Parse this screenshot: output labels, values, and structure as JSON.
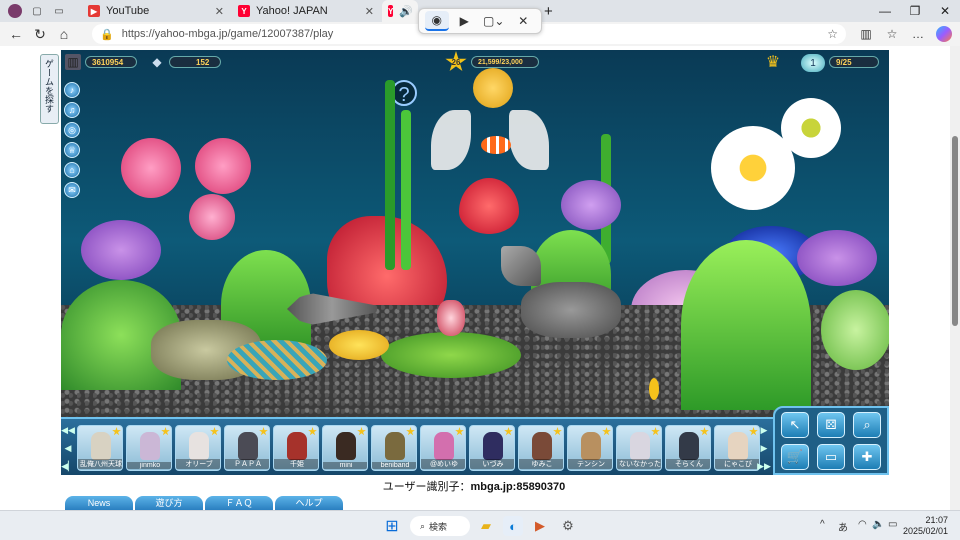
{
  "browser": {
    "tabs": [
      {
        "label": "YouTube",
        "active": false
      },
      {
        "label": "Yahoo! JAPAN",
        "active": false
      },
      {
        "label": "",
        "active": true
      }
    ],
    "url": "https://yahoo-mbga.jp/game/12007387/play"
  },
  "game": {
    "side_tab_label": "ゲームを探す",
    "coins": "3610954",
    "gems": "152",
    "level": "26",
    "exp": "21,599/23,000",
    "crown_count": "9/25",
    "friends": [
      {
        "name": "乱俺八州天球",
        "color": "#d8d2c2"
      },
      {
        "name": "jinmko",
        "color": "#cbb7d6"
      },
      {
        "name": "オリーブ",
        "color": "#e7e2e0"
      },
      {
        "name": "ＰＡＰＡ",
        "color": "#4b4b55"
      },
      {
        "name": "千姫",
        "color": "#a6322b"
      },
      {
        "name": "mini",
        "color": "#3a2a22"
      },
      {
        "name": "beniband",
        "color": "#7a6a3e"
      },
      {
        "name": "@めいゆ",
        "color": "#d36fae"
      },
      {
        "name": "いづみ",
        "color": "#2f2d60"
      },
      {
        "name": "ゆみこ",
        "color": "#7a4a38"
      },
      {
        "name": "テンシン",
        "color": "#b89060"
      },
      {
        "name": "ないなかった",
        "color": "#d9d6e0"
      },
      {
        "name": "そらくん",
        "color": "#333a48"
      },
      {
        "name": "にゃこび",
        "color": "#e6d4c0"
      }
    ]
  },
  "user_id": {
    "label": "ユーザー識別子：",
    "value": "mbga.jp:85890370"
  },
  "bottom_tabs": [
    "News",
    "遊び方",
    "ＦＡＱ",
    "ヘルプ"
  ],
  "taskbar": {
    "search_label": "検索",
    "ime": "あ",
    "time": "21:07",
    "date": "2025/02/01"
  }
}
